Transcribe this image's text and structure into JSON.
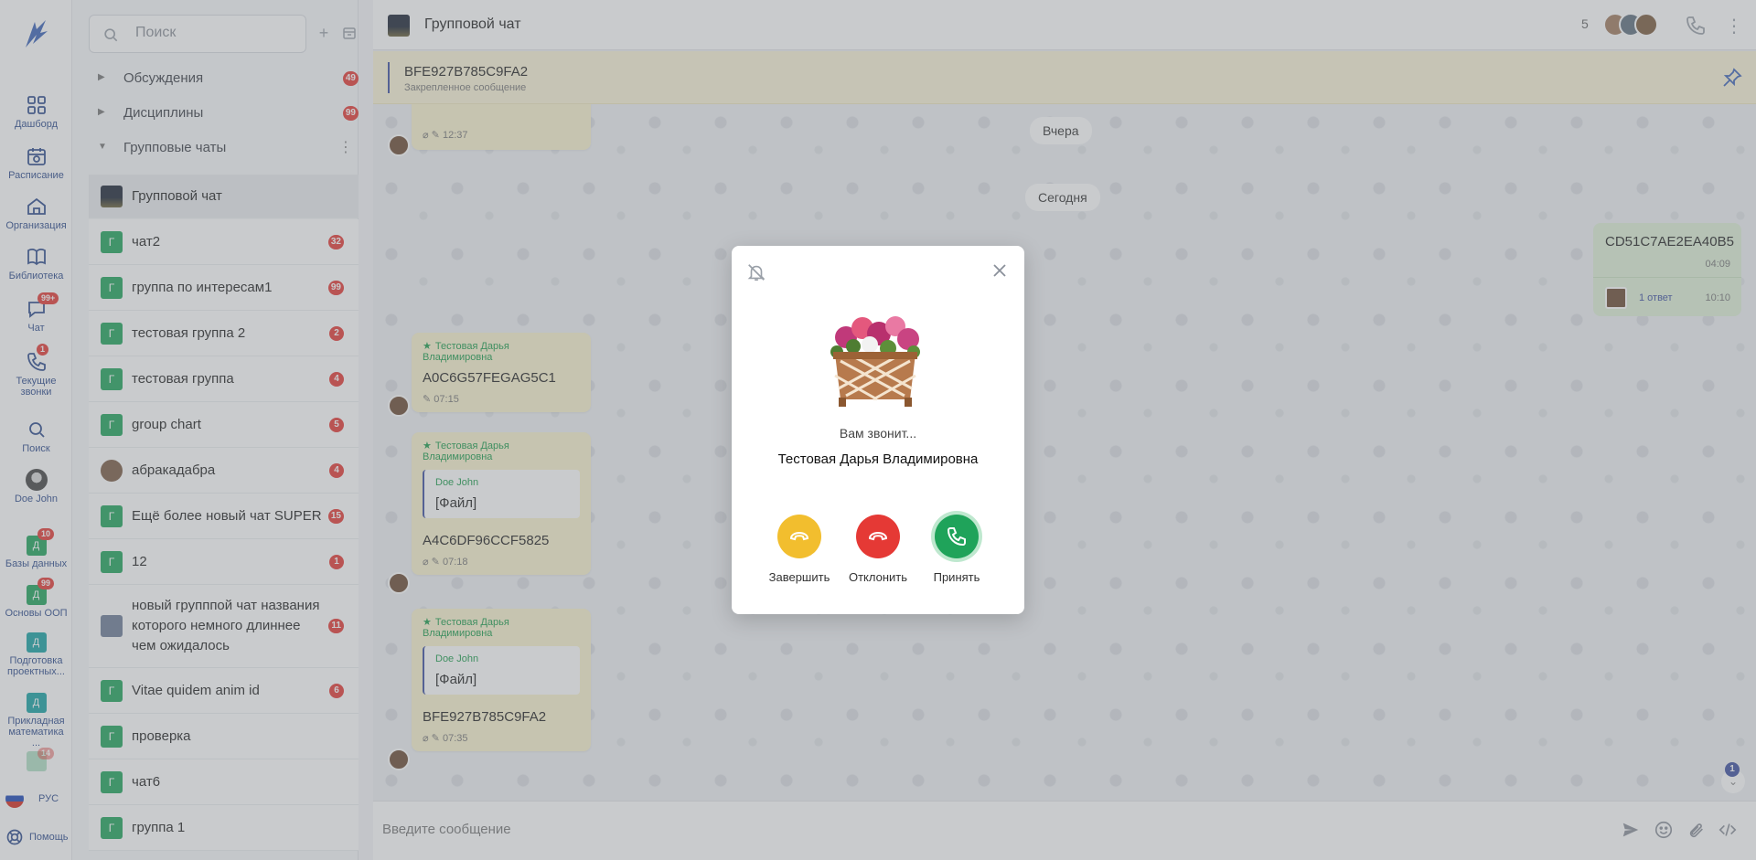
{
  "rail": {
    "items": [
      {
        "label": "Дашборд"
      },
      {
        "label": "Расписание"
      },
      {
        "label": "Организация"
      },
      {
        "label": "Библиотека"
      },
      {
        "label": "Чат",
        "badge": "99+"
      },
      {
        "label": "Текущие звонки",
        "badge": "1"
      },
      {
        "label": "Поиск"
      },
      {
        "label": "Doe John"
      },
      {
        "label": "Базы данных",
        "badge": "10",
        "letter": "Д"
      },
      {
        "label": "Основы ООП",
        "badge": "99",
        "letter": "Д"
      },
      {
        "label": "Подготовка проектных...",
        "letter": "Д"
      },
      {
        "label": "Прикладная математика ...",
        "letter": "Д"
      },
      {
        "badge": "14"
      }
    ],
    "language": "РУС",
    "help": "Помощь"
  },
  "list": {
    "search_placeholder": "Поиск",
    "folders": [
      {
        "label": "Обсуждения",
        "badge": "49"
      },
      {
        "label": "Дисциплины",
        "badge": "99"
      },
      {
        "label": "Групповые чаты"
      }
    ],
    "chats": [
      {
        "name": "Групповой чат",
        "avatar": "photo",
        "badge": ""
      },
      {
        "name": "чат2",
        "letter": "Г",
        "badge": "32"
      },
      {
        "name": "группа по интересам1",
        "letter": "Г",
        "badge": "99"
      },
      {
        "name": "тестовая группа 2",
        "letter": "Г",
        "badge": "2"
      },
      {
        "name": "тестовая группа",
        "letter": "Г",
        "badge": "4"
      },
      {
        "name": "group chart",
        "letter": "Г",
        "badge": "5"
      },
      {
        "name": "абракадабра",
        "avatar": "round",
        "badge": "4"
      },
      {
        "name": "Ещё более новый чат SUPER",
        "letter": "Г",
        "badge": "15"
      },
      {
        "name": "12",
        "letter": "Г",
        "badge": "1"
      },
      {
        "name": "новый групппой чат названия которого немного длиннее чем ожидалось",
        "avatar": "blue",
        "badge": "11"
      },
      {
        "name": "Vitae quidem anim id",
        "letter": "Г",
        "badge": "6"
      },
      {
        "name": "проверка",
        "letter": "Г",
        "badge": ""
      },
      {
        "name": "чат6",
        "letter": "Г",
        "badge": ""
      },
      {
        "name": "группа 1",
        "letter": "Г",
        "badge": ""
      }
    ]
  },
  "header": {
    "title": "Групповой чат",
    "members_count": "5"
  },
  "pinned": {
    "title": "BFE927B785C9FA2",
    "subtitle": "Закрепленное сообщение"
  },
  "messages": {
    "day_yesterday": "Вчера",
    "day_today": "Сегодня",
    "partial_time": "12:37",
    "m1": {
      "author": "Тестовая Дарья Владимировна",
      "text": "A0C6G57FEGAG5C1",
      "time": "07:15"
    },
    "m2": {
      "author": "Тестовая Дарья Владимировна",
      "quote_author": "Doe John",
      "quote_text": "[Файл]",
      "text": "A4C6DF96CCF5825",
      "time": "07:18"
    },
    "m3": {
      "author": "Тестовая Дарья Владимировна",
      "quote_author": "Doe John",
      "quote_text": "[Файл]",
      "text": "BFE927B785C9FA2",
      "time": "07:35"
    },
    "own": {
      "text": "CD51C7AE2EA40B5",
      "time": "04:09",
      "reply_label": "1 ответ",
      "reply_time": "10:10"
    },
    "scroll_badge": "1"
  },
  "composer": {
    "placeholder": "Введите сообщение"
  },
  "call_modal": {
    "calling_text": "Вам звонит...",
    "caller_name": "Тестовая Дарья Владимировна",
    "end_label": "Завершить",
    "decline_label": "Отклонить",
    "accept_label": "Принять",
    "colors": {
      "end": "#f2be2e",
      "decline": "#e53935",
      "accept": "#1fa35a"
    }
  }
}
